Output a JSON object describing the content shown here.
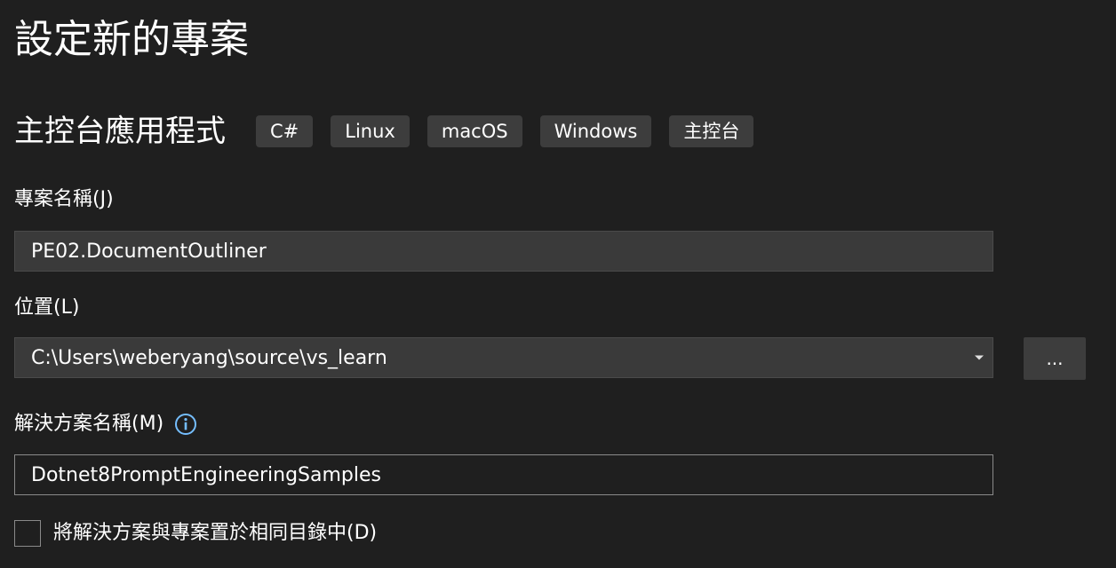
{
  "page": {
    "title": "設定新的專案"
  },
  "template": {
    "name": "主控台應用程式",
    "tags": [
      "C#",
      "Linux",
      "macOS",
      "Windows",
      "主控台"
    ]
  },
  "project_name": {
    "label": "專案名稱(J)",
    "value": "PE02.DocumentOutliner"
  },
  "location": {
    "label": "位置(L)",
    "value": "C:\\Users\\weberyang\\source\\vs_learn",
    "browse_label": "..."
  },
  "solution_name": {
    "label": "解決方案名稱(M)",
    "value": "Dotnet8PromptEngineeringSamples",
    "info_icon": "info-icon"
  },
  "same_directory": {
    "label": "將解決方案與專案置於相同目錄中(D)",
    "checked": false
  },
  "colors": {
    "background": "#1f1f1f",
    "tag_background": "#3d3d3d",
    "input_background": "#3a3a3a",
    "input_border_focus": "#8a8a8a",
    "info_icon": "#75beff"
  }
}
